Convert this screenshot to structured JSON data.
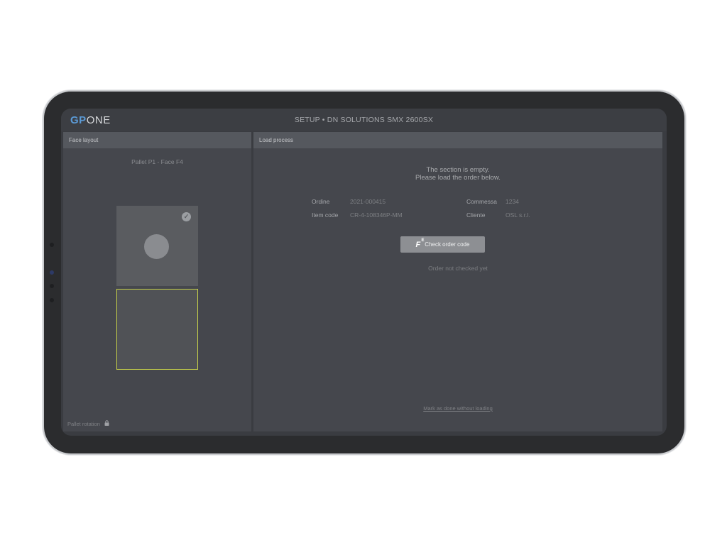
{
  "app": {
    "logo_gp": "GP",
    "logo_one": "ONE",
    "title": "SETUP • DN SOLUTIONS SMX 2600SX"
  },
  "face_layout": {
    "header": "Face layout",
    "face_title": "Pallet P1 - Face F4",
    "pallet_rotation_label": "Pallet rotation",
    "check_icon": "check-circle-icon",
    "lock_icon": "lock-icon"
  },
  "load_process": {
    "header": "Load process",
    "empty_line1": "The section is empty.",
    "empty_line2": "Please load the order below.",
    "fields": {
      "ordine_label": "Ordine",
      "ordine_value": "2021-000415",
      "commessa_label": "Commessa",
      "commessa_value": "1234",
      "item_code_label": "Item code",
      "item_code_value": "CR-4-108346P-MM",
      "cliente_label": "Cliente",
      "cliente_value": "OSL s.r.l."
    },
    "check_button_label": "Check order code",
    "order_status": "Order not checked yet",
    "mark_done_link": "Mark as done without loading"
  },
  "colors": {
    "accent_blue": "#5b9ad6",
    "selected_outline": "#c8d24a",
    "panel_bg": "#45474d"
  }
}
